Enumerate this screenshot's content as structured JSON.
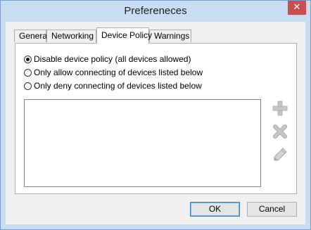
{
  "window": {
    "title": "Prefereneces",
    "close_symbol": "✕"
  },
  "tabs": [
    {
      "label": "General"
    },
    {
      "label": "Networking"
    },
    {
      "label": "Device Policy",
      "active": true
    },
    {
      "label": "Warnings"
    }
  ],
  "policy_options": [
    {
      "label": "Disable device policy (all devices allowed)",
      "checked": true
    },
    {
      "label": "Only allow connecting of devices listed below",
      "checked": false
    },
    {
      "label": "Only deny connecting of devices listed below",
      "checked": false
    }
  ],
  "device_list": {
    "items": []
  },
  "side_buttons": {
    "add_icon": "plus-icon",
    "remove_icon": "x-icon",
    "edit_icon": "pencil-icon"
  },
  "buttons": {
    "ok_label": "OK",
    "cancel_label": "Cancel"
  },
  "colors": {
    "titlebar": "#c8dcf2",
    "close_button": "#c74f4f",
    "default_button_border": "#3c7fb1"
  }
}
